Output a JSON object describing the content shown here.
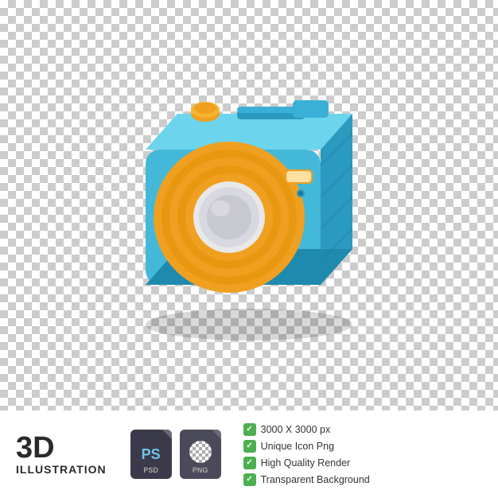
{
  "background": {
    "type": "transparent_checkered"
  },
  "camera": {
    "colors": {
      "body": "#44b8d8",
      "body_dark": "#2a9bbf",
      "body_shadow": "#1a7a99",
      "lens_ring": "#f0a020",
      "lens_inner": "#e8e8e8",
      "lens_center": "#d0d0d8",
      "button_top": "#f0a020",
      "viewfinder": "#f0a020",
      "top_face": "#5ecde8",
      "right_face": "#2a9bbf"
    }
  },
  "info_panel": {
    "title_3d": "3D",
    "title_sub": "ILLUSTRATION",
    "file_types": [
      {
        "label": "PS",
        "sublabel": "PSD",
        "type": "ps"
      },
      {
        "label": "",
        "sublabel": "PNG",
        "type": "png"
      }
    ],
    "features": [
      "3000 X 3000 px",
      "Unique Icon Png",
      "High Quality Render",
      "Transparent Background"
    ]
  }
}
